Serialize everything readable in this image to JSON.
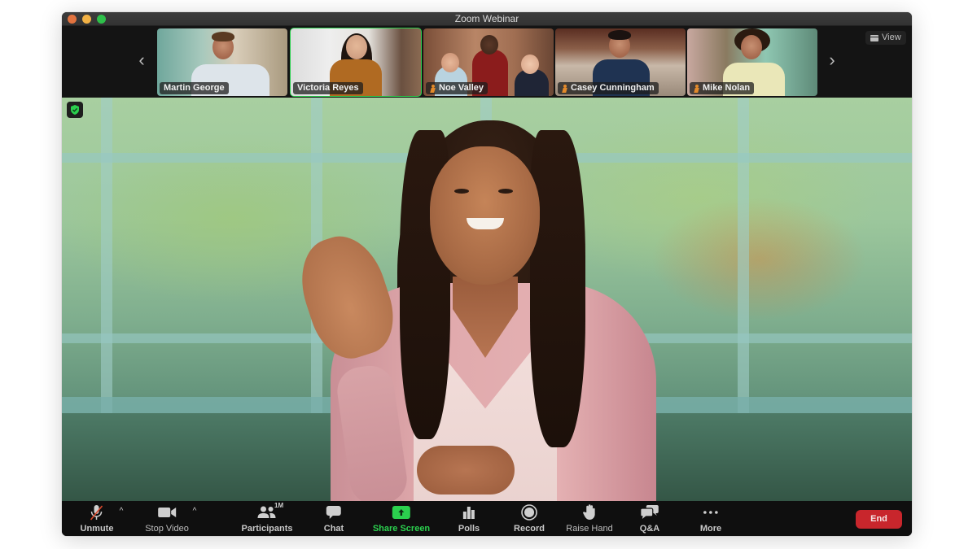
{
  "window": {
    "title": "Zoom Webinar"
  },
  "gallery": {
    "prev_icon": "chevron-left-icon",
    "next_icon": "chevron-right-icon",
    "view_button": {
      "label": "View",
      "icon": "grid-icon"
    },
    "participants": [
      {
        "name": "Martin George",
        "spotlight": false,
        "active": false
      },
      {
        "name": "Victoria Reyes",
        "spotlight": false,
        "active": true
      },
      {
        "name": "Noe Valley",
        "spotlight": true,
        "active": false
      },
      {
        "name": "Casey Cunningham",
        "spotlight": true,
        "active": false
      },
      {
        "name": "Mike Nolan",
        "spotlight": true,
        "active": false
      }
    ]
  },
  "main_video": {
    "security_badge_icon": "shield-check-icon"
  },
  "toolbar": {
    "unmute": {
      "label": "Unmute",
      "icon": "microphone-muted-icon"
    },
    "stop_video": {
      "label": "Stop Video",
      "icon": "video-camera-icon"
    },
    "participants": {
      "label": "Participants",
      "icon": "participants-icon",
      "count": "1M"
    },
    "chat": {
      "label": "Chat",
      "icon": "chat-bubble-icon"
    },
    "share_screen": {
      "label": "Share Screen",
      "icon": "share-screen-arrow-icon"
    },
    "polls": {
      "label": "Polls",
      "icon": "bar-chart-icon"
    },
    "record": {
      "label": "Record",
      "icon": "record-icon"
    },
    "raise_hand": {
      "label": "Raise Hand",
      "icon": "hand-icon"
    },
    "qa": {
      "label": "Q&A",
      "icon": "qa-bubbles-icon"
    },
    "more": {
      "label": "More",
      "icon": "ellipsis-icon"
    },
    "end": {
      "label": "End"
    },
    "caret_glyph": "^"
  },
  "colors": {
    "accent_green": "#2bd04e",
    "end_red": "#c8262c",
    "toolbar_bg": "#0f0f0f",
    "spotlight_orange": "#e38a2b"
  }
}
